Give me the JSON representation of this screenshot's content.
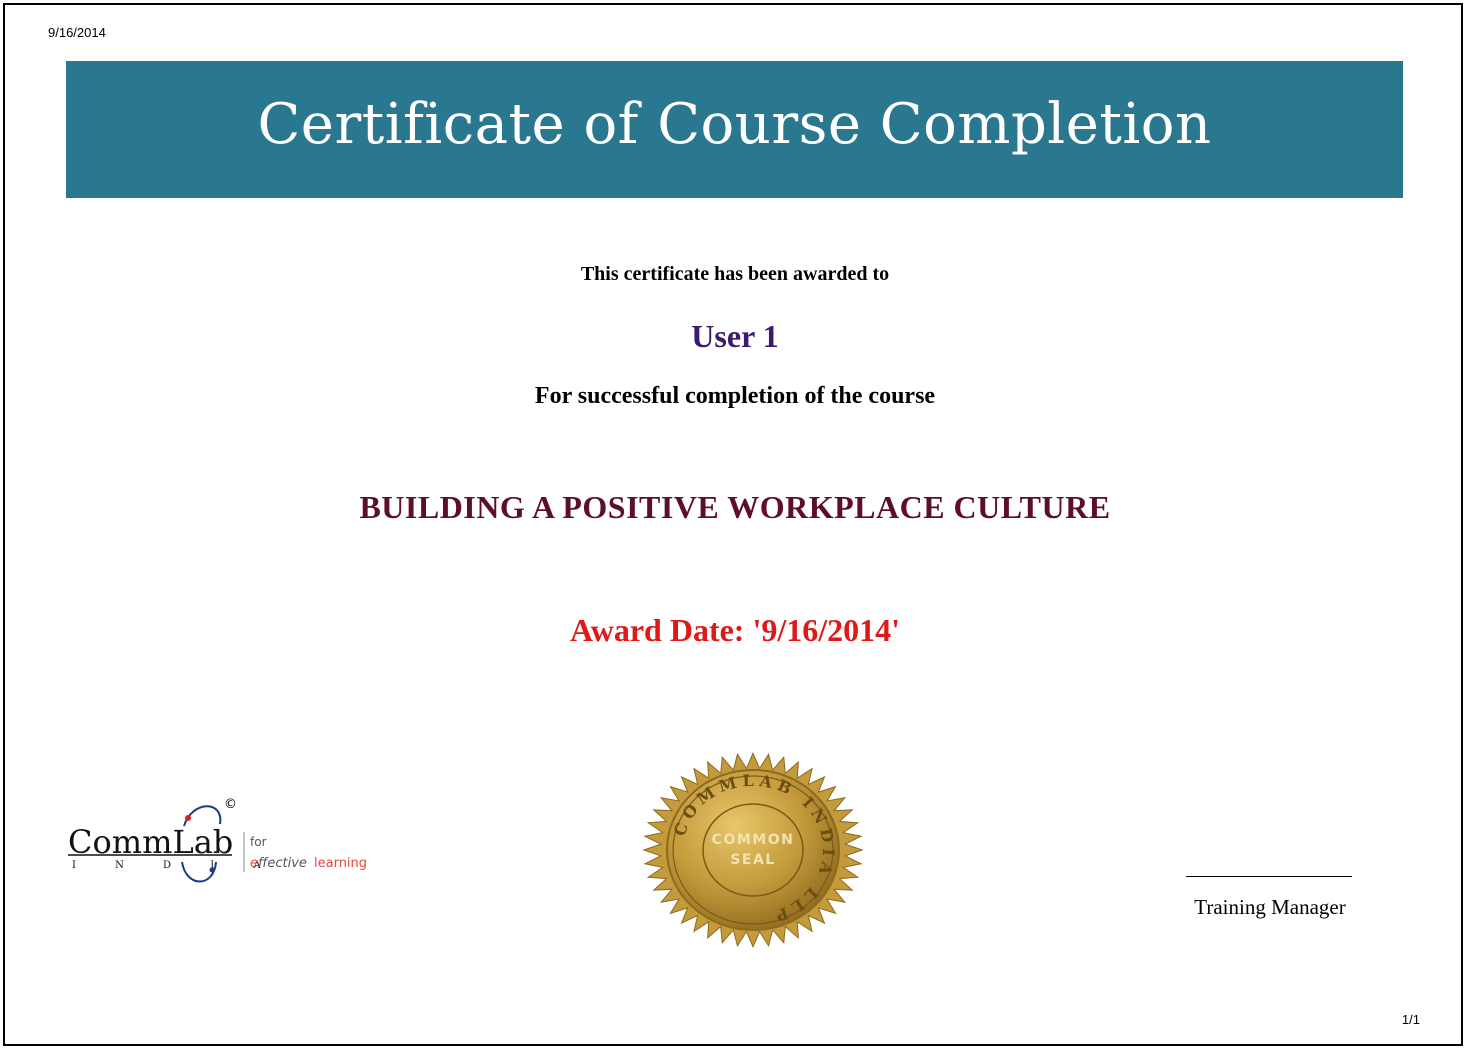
{
  "header": {
    "print_date": "9/16/2014",
    "page_number": "1/1"
  },
  "banner": {
    "title": "Certificate of Course Completion",
    "color": "#2a7790"
  },
  "certificate": {
    "awarded_to_text": "This certificate has been awarded to",
    "recipient": "User 1",
    "completion_text": "For successful completion of the course",
    "course_name": "BUILDING A POSITIVE WORKPLACE CULTURE",
    "award_date": "Award Date: '9/16/2014'",
    "colors": {
      "recipient": "#3b1a6e",
      "course_name": "#5e0d2c",
      "award_date": "#e01818"
    }
  },
  "logo": {
    "brand": "CommLab",
    "country": "I N D I A",
    "copyright": "©",
    "tagline_prefix": "for",
    "tagline_e": "e",
    "tagline_effective": "ffective",
    "tagline_learning": "learning",
    "tagline_color": "#e8473a"
  },
  "seal": {
    "ring_text": "COMMLAB INDIA LLP",
    "center_line1": "COMMON",
    "center_line2": "SEAL",
    "color": "#c39a3c"
  },
  "signature": {
    "title": "Training Manager"
  }
}
